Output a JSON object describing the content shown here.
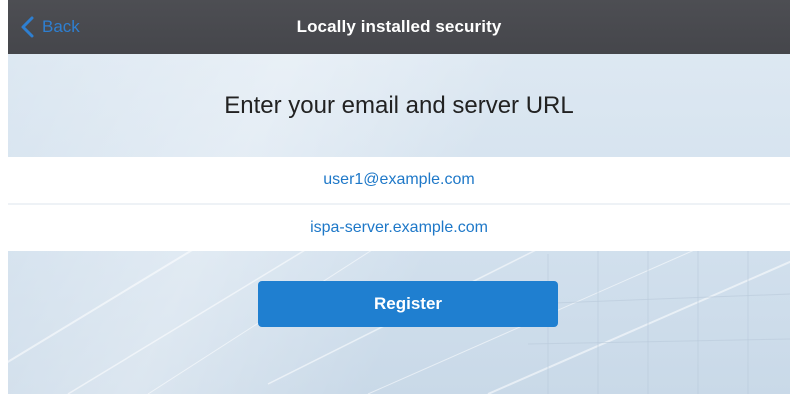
{
  "navbar": {
    "back_label": "Back",
    "title": "Locally installed security"
  },
  "main": {
    "headline": "Enter your email and server URL",
    "email_value": "user1@example.com",
    "server_value": "ispa-server.example.com",
    "register_label": "Register"
  },
  "colors": {
    "navbar_bg": "#4d4e53",
    "accent": "#1f7fd0",
    "link": "#1e78c8"
  },
  "icons": {
    "back": "chevron-left-icon"
  }
}
